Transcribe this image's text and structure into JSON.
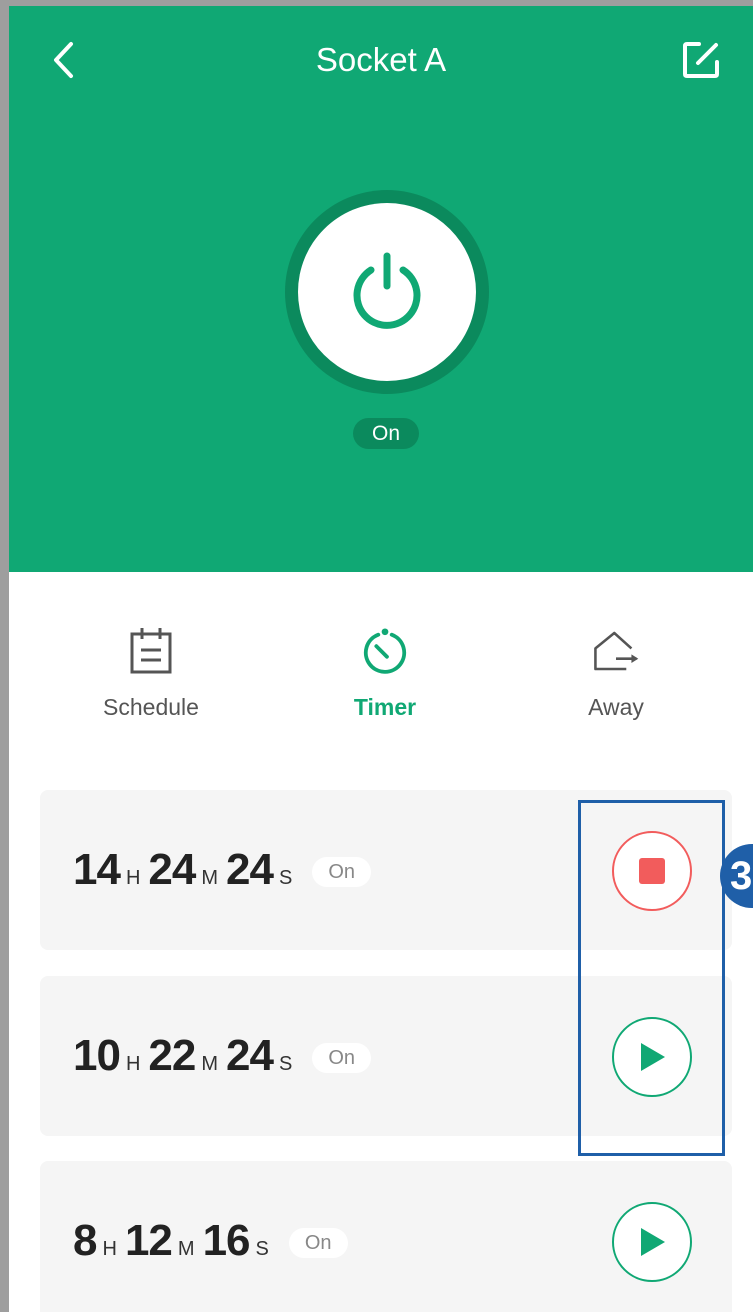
{
  "header": {
    "title": "Socket A",
    "status": "On",
    "icons": {
      "back": "chevron-left-icon",
      "edit": "edit-icon",
      "power": "power-icon"
    }
  },
  "tabs": [
    {
      "label": "Schedule",
      "icon": "calendar-icon",
      "active": false
    },
    {
      "label": "Timer",
      "icon": "timer-icon",
      "active": true
    },
    {
      "label": "Away",
      "icon": "away-home-icon",
      "active": false
    }
  ],
  "timers": [
    {
      "hours": "14",
      "h_unit": "H",
      "minutes": "24",
      "m_unit": "M",
      "seconds": "24",
      "s_unit": "S",
      "state": "On",
      "action": "stop"
    },
    {
      "hours": "10",
      "h_unit": "H",
      "minutes": "22",
      "m_unit": "M",
      "seconds": "24",
      "s_unit": "S",
      "state": "On",
      "action": "play"
    },
    {
      "hours": "8",
      "h_unit": "H",
      "minutes": "12",
      "m_unit": "M",
      "seconds": "16",
      "s_unit": "S",
      "state": "On",
      "action": "play"
    }
  ],
  "annotation": {
    "badge": "3"
  },
  "colors": {
    "accent": "#10a874",
    "accent_dark": "#0b8a5d",
    "stop": "#f25c5c",
    "annotation": "#1f5fa8"
  }
}
